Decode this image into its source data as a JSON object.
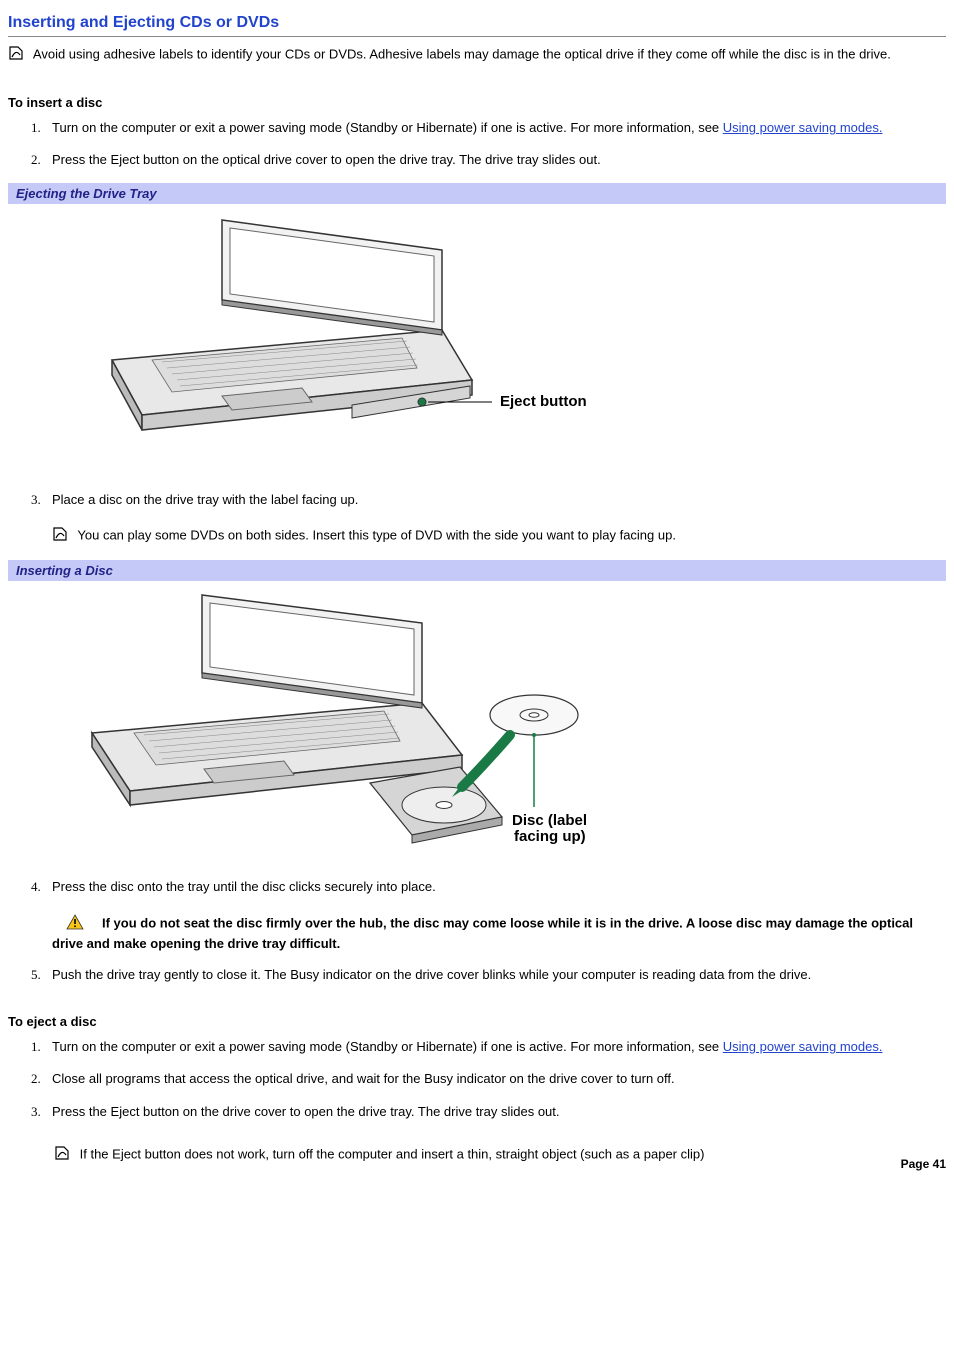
{
  "heading": "Inserting and Ejecting CDs or DVDs",
  "note1": "Avoid using adhesive labels to identify your CDs or DVDs. Adhesive labels may damage the optical drive if they come off while the disc is in the drive.",
  "insert_heading": "To insert a disc",
  "insert_step1a": "Turn on the computer or exit a power saving mode (Standby or Hibernate) if one is active. For more information, see ",
  "insert_step1_link": "Using power saving modes.",
  "insert_step2": "Press the Eject button on the optical drive cover to open the drive tray. The drive tray slides out.",
  "caption1": "Ejecting the Drive Tray",
  "fig1_label": "Eject button",
  "insert_step3": "Place a disc on the drive tray with the label facing up.",
  "note2": "You can play some DVDs on both sides. Insert this type of DVD with the side you want to play facing up.",
  "caption2": "Inserting a Disc",
  "fig2_label1": "Disc (label",
  "fig2_label2": "facing up)",
  "insert_step4": "Press the disc onto the tray until the disc clicks securely into place.",
  "warning": "If you do not seat the disc firmly over the hub, the disc may come loose while it is in the drive. A loose disc may damage the optical drive and make opening the drive tray difficult.",
  "insert_step5": "Push the drive tray gently to close it. The Busy indicator on the drive cover blinks while your computer is reading data from the drive.",
  "eject_heading": "To eject a disc",
  "eject_step1a": "Turn on the computer or exit a power saving mode (Standby or Hibernate) if one is active. For more information, see ",
  "eject_step1_link": "Using power saving modes.",
  "eject_step2": "Close all programs that access the optical drive, and wait for the Busy indicator on the drive cover to turn off.",
  "eject_step3": "Press the Eject button on the drive cover to open the drive tray. The drive tray slides out.",
  "note3": "If the Eject button does not work, turn off the computer and insert a thin, straight object (such as a paper clip)",
  "page_label": "Page 41"
}
